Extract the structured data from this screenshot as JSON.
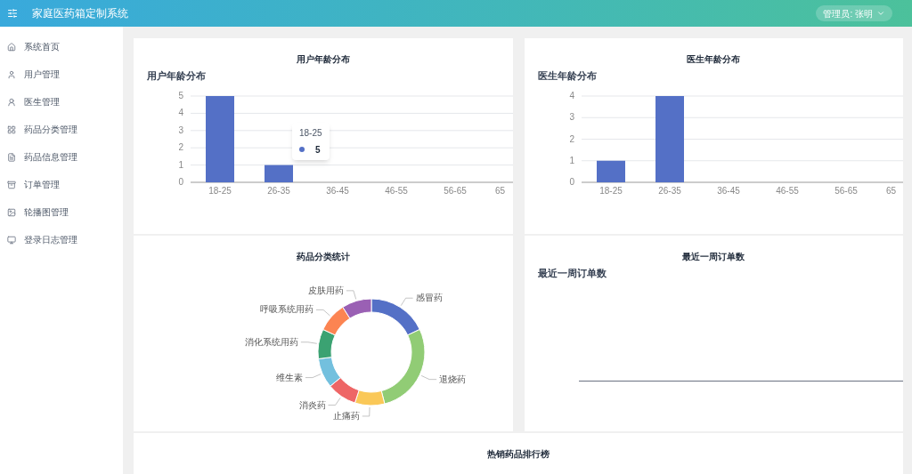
{
  "header": {
    "title": "家庭医药箱定制系统",
    "user": "管理员: 张明"
  },
  "sidebar": {
    "items": [
      {
        "label": "系统首页"
      },
      {
        "label": "用户管理"
      },
      {
        "label": "医生管理"
      },
      {
        "label": "药品分类管理"
      },
      {
        "label": "药品信息管理"
      },
      {
        "label": "订单管理"
      },
      {
        "label": "轮播图管理"
      },
      {
        "label": "登录日志管理"
      }
    ]
  },
  "cards": [
    {
      "kind": "bar",
      "title": "用户年龄分布",
      "subtitle": "用户年龄分布",
      "tooltip": {
        "label": "18-25",
        "value": "5"
      },
      "chart_data": {
        "type": "bar",
        "categories": [
          "18-25",
          "26-35",
          "36-45",
          "46-55",
          "56-65",
          "65"
        ],
        "series": [
          {
            "color": "#5470c6",
            "values": [
              5,
              1,
              0,
              0,
              0,
              0
            ]
          }
        ],
        "grid": true,
        "ylim": [
          0,
          5
        ],
        "yticks": [
          0,
          1,
          2,
          3,
          4,
          5
        ]
      }
    },
    {
      "kind": "bar",
      "title": "医生年龄分布",
      "subtitle": "医生年龄分布",
      "chart_data": {
        "type": "bar",
        "categories": [
          "18-25",
          "26-35",
          "36-45",
          "46-55",
          "56-65",
          "65"
        ],
        "series": [
          {
            "color": "#5470c6",
            "values": [
              1,
              4,
              0,
              0,
              0,
              0
            ]
          }
        ],
        "grid": true,
        "ylim": [
          0,
          4
        ],
        "yticks": [
          0,
          1,
          2,
          3,
          4
        ]
      }
    },
    {
      "kind": "donut",
      "title": "药品分类统计",
      "chart_data": {
        "type": "donut",
        "categories": [
          "感冒药",
          "退烧药",
          "止痛药",
          "消炎药",
          "维生素",
          "消化系统用药",
          "呼吸系统用药",
          "皮肤用药"
        ],
        "series": [
          {
            "values": [
              18,
              28,
              9,
              9,
              9,
              9,
              9,
              9
            ]
          }
        ],
        "colors": [
          "#5470c6",
          "#91cc75",
          "#fac858",
          "#ee6666",
          "#73c0de",
          "#3ba272",
          "#fc8452",
          "#9a60b4"
        ]
      }
    },
    {
      "kind": "line",
      "title": "最近一周订单数",
      "subtitle": "最近一周订单数"
    },
    {
      "kind": "table",
      "title": "热销药品排行榜"
    }
  ]
}
